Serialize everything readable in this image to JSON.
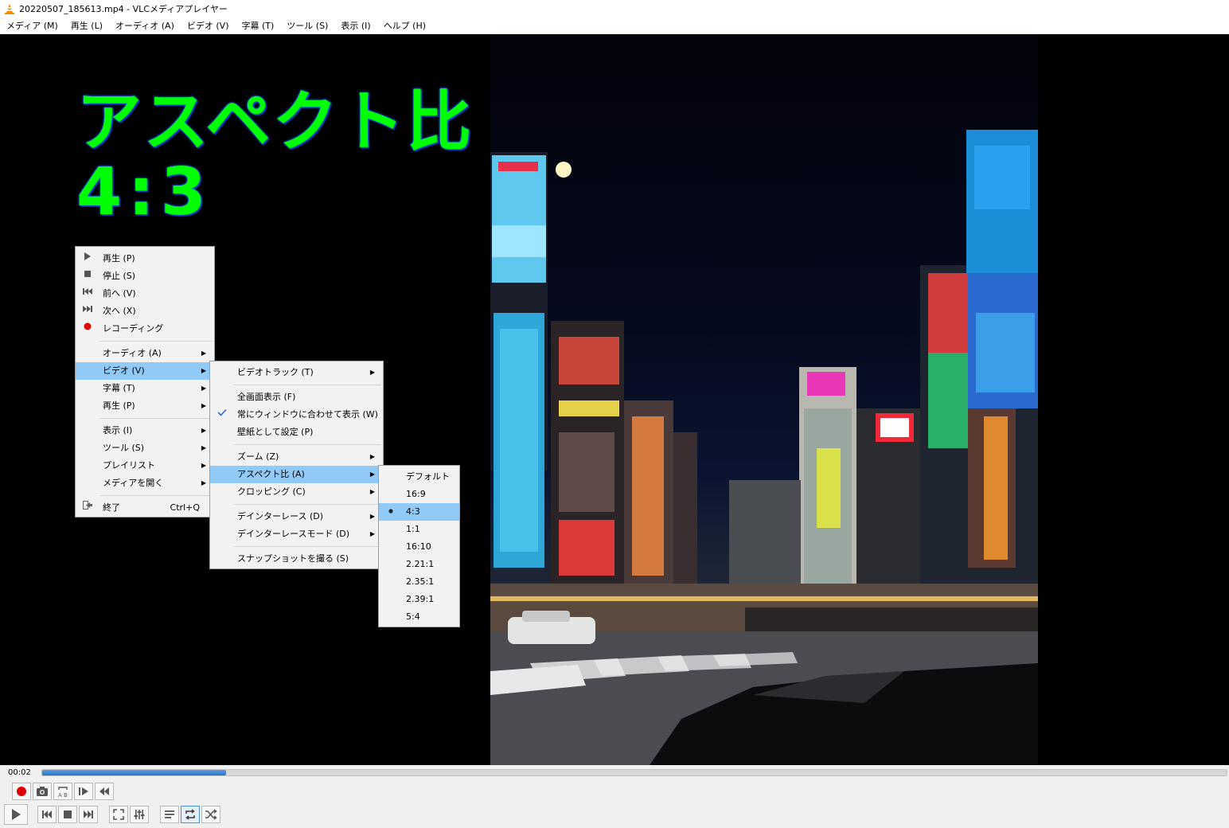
{
  "window": {
    "title": "20220507_185613.mp4 - VLCメディアプレイヤー"
  },
  "menubar": [
    "メディア (M)",
    "再生 (L)",
    "オーディオ (A)",
    "ビデオ (V)",
    "字幕 (T)",
    "ツール (S)",
    "表示 (I)",
    "ヘルプ (H)"
  ],
  "overlay": {
    "line1": "アスペクト比",
    "line2": "4:3",
    "color": "#00ff00"
  },
  "context_menu": {
    "items": [
      {
        "icon": "play-icon",
        "label": "再生 (P)"
      },
      {
        "icon": "stop-icon",
        "label": "停止 (S)"
      },
      {
        "icon": "previous-icon",
        "label": "前へ (V)"
      },
      {
        "icon": "next-icon",
        "label": "次へ (X)"
      },
      {
        "icon": "record-icon",
        "label": "レコーディング"
      },
      {
        "label": "オーディオ (A)",
        "submenu": true
      },
      {
        "label": "ビデオ (V)",
        "submenu": true,
        "selected": true
      },
      {
        "label": "字幕 (T)",
        "submenu": true
      },
      {
        "label": "再生 (P)",
        "submenu": true
      },
      {
        "label": "表示 (I)",
        "submenu": true
      },
      {
        "label": "ツール (S)",
        "submenu": true
      },
      {
        "label": "プレイリスト",
        "submenu": true
      },
      {
        "label": "メディアを開く",
        "submenu": true
      },
      {
        "icon": "exit-icon",
        "label": "終了",
        "shortcut": "Ctrl+Q"
      }
    ]
  },
  "video_menu": {
    "items": [
      {
        "label": "ビデオトラック (T)",
        "submenu": true
      },
      {
        "label": "全画面表示 (F)"
      },
      {
        "label": "常にウィンドウに合わせて表示 (W)",
        "checked": true
      },
      {
        "label": "壁紙として設定 (P)"
      },
      {
        "label": "ズーム (Z)",
        "submenu": true
      },
      {
        "label": "アスペクト比 (A)",
        "submenu": true,
        "selected": true
      },
      {
        "label": "クロッピング (C)",
        "submenu": true
      },
      {
        "label": "デインターレース (D)",
        "submenu": true
      },
      {
        "label": "デインターレースモード (D)",
        "submenu": true
      },
      {
        "label": "スナップショットを撮る (S)"
      }
    ]
  },
  "aspect_menu": {
    "items": [
      "デフォルト",
      "16:9",
      "4:3",
      "1:1",
      "16:10",
      "2.21:1",
      "2.35:1",
      "2.39:1",
      "5:4"
    ],
    "selected": "4:3"
  },
  "playback": {
    "elapsed": "00:02",
    "progress": 0.155,
    "accent": "#2b73c6"
  }
}
